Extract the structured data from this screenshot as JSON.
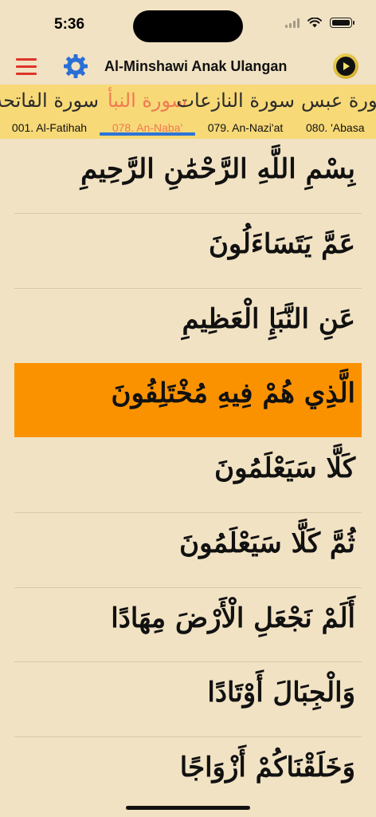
{
  "status": {
    "time": "5:36"
  },
  "nav": {
    "title": "Al-Minshawi Anak Ulangan"
  },
  "tabs": [
    {
      "arabic": "سورة الفاتحة",
      "label": "001. Al-Fatihah"
    },
    {
      "arabic": "سورة النبأ",
      "label": "078. An-Naba'"
    },
    {
      "arabic": "سورة النازعات",
      "label": "079. An-Nazi'at"
    },
    {
      "arabic": "سورة عبس",
      "label": "080. 'Abasa"
    }
  ],
  "active_tab": 1,
  "verses": [
    "بِسْمِ اللَّهِ الرَّحْمَٰنِ الرَّحِيمِ",
    "عَمَّ يَتَسَاءَلُونَ",
    "عَنِ النَّبَإِ الْعَظِيمِ",
    "الَّذِي هُمْ فِيهِ مُخْتَلِفُونَ",
    "كَلَّا سَيَعْلَمُونَ",
    "ثُمَّ كَلَّا سَيَعْلَمُونَ",
    "أَلَمْ نَجْعَلِ الْأَرْضَ مِهَادًا",
    "وَالْجِبَالَ أَوْتَادًا",
    "وَخَلَقْنَاكُمْ أَزْوَاجًا"
  ],
  "active_verse": 3,
  "colors": {
    "background": "#f1e2c3",
    "tab_bar": "#f7d977",
    "highlight": "#fa9200",
    "accent_red": "#e0332b",
    "accent_blue": "#2c74d8",
    "active_tab": "#f07a52"
  }
}
